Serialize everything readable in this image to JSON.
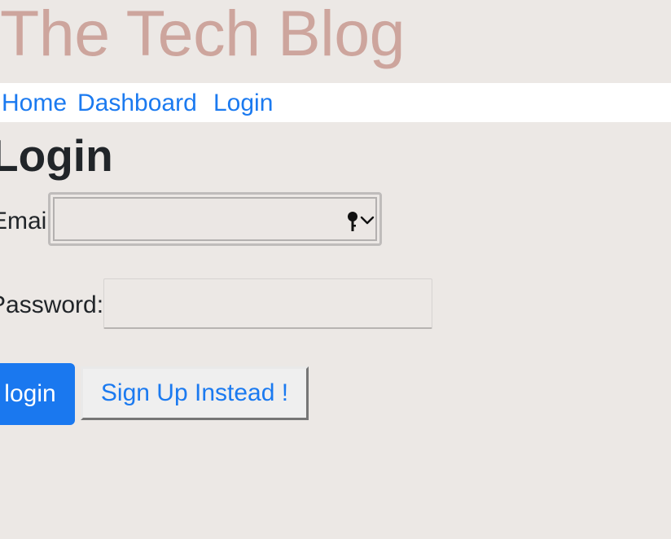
{
  "site": {
    "title": "The Tech Blog"
  },
  "nav": {
    "home_label": "Home",
    "dashboard_label": "Dashboard",
    "login_label": "Login"
  },
  "main": {
    "heading": "Login",
    "email": {
      "label": "Email:",
      "value": "",
      "placeholder": ""
    },
    "password": {
      "label": "Password:",
      "value": "",
      "placeholder": ""
    },
    "login_button_label": "login",
    "signup_button_label": "Sign Up Instead !"
  },
  "icons": {
    "key": "key-icon",
    "chevron": "chevron-down-icon"
  },
  "colors": {
    "background": "#ece8e5",
    "title": "#cda59d",
    "link": "#1b7af0",
    "primary_button": "#1a78ef",
    "nav_background": "#ffffff"
  }
}
